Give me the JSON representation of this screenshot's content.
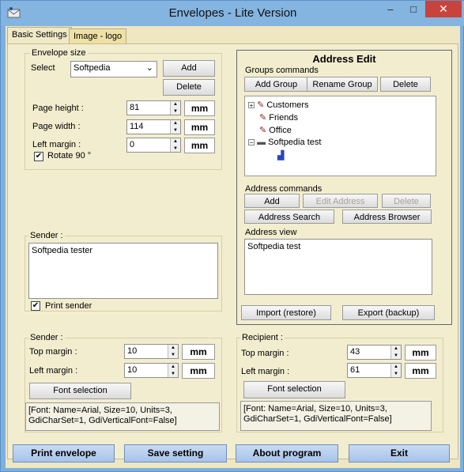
{
  "window": {
    "title": "Envelopes - Lite Version",
    "minimize": "–",
    "maximize": "□",
    "close": "✕"
  },
  "tabs": [
    "Basic Settings",
    "Image - logo"
  ],
  "envelope_size": {
    "title": "Envelope size",
    "select_label": "Select",
    "selected": "Softpedia",
    "add": "Add",
    "delete": "Delete",
    "page_height_label": "Page height :",
    "page_height": "81",
    "page_width_label": "Page width :",
    "page_width": "114",
    "left_margin_label": "Left margin :",
    "left_margin": "0",
    "unit": "mm",
    "rotate_label": "Rotate 90 °",
    "rotate_checked": true
  },
  "sender_text": {
    "title": "Sender :",
    "value": "Softpedia tester",
    "print_label": "Print sender",
    "print_checked": true
  },
  "sender_margins": {
    "title": "Sender :",
    "top_label": "Top margin :",
    "top": "10",
    "left_label": "Left margin :",
    "left": "10",
    "unit": "mm",
    "font_button": "Font selection",
    "font_info": "[Font: Name=Arial, Size=10, Units=3, GdiCharSet=1, GdiVerticalFont=False]"
  },
  "recipient": {
    "title": "Recipient :",
    "top_label": "Top margin :",
    "top": "43",
    "left_label": "Left margin :",
    "left": "61",
    "unit": "mm",
    "font_button": "Font selection",
    "font_info": "[Font: Name=Arial, Size=10, Units=3, GdiCharSet=1, GdiVerticalFont=False]"
  },
  "address_edit": {
    "title": "Address Edit",
    "groups_title": "Groups commands",
    "add_group": "Add Group",
    "rename_group": "Rename Group",
    "delete": "Delete",
    "tree": [
      "Customers",
      "Friends",
      "Office",
      "Softpedia test"
    ],
    "address_commands_title": "Address commands",
    "add": "Add",
    "edit_address": "Edit Address",
    "delete_address": "Delete",
    "address_search": "Address Search",
    "address_browser": "Address Browser",
    "address_view_title": "Address view",
    "address_view_value": "Softpedia test",
    "import": "Import (restore)",
    "export": "Export (backup)"
  },
  "bottom": {
    "print": "Print envelope",
    "save": "Save setting",
    "about": "About program",
    "exit": "Exit"
  }
}
